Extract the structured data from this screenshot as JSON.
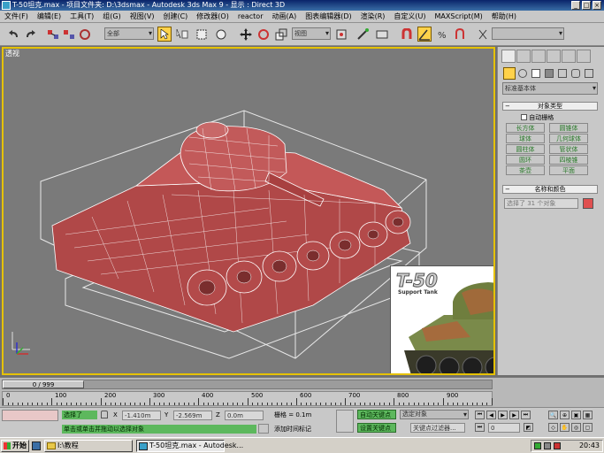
{
  "window": {
    "title": "T-50坦克.max    - 项目文件夹: D:\\3dsmax    - Autodesk 3ds Max 9    - 显示 : Direct 3D",
    "btn_min": "_",
    "btn_max": "□",
    "btn_close": "×"
  },
  "menu": [
    "文件(F)",
    "编辑(E)",
    "工具(T)",
    "组(G)",
    "视图(V)",
    "创建(C)",
    "修改器(O)",
    "reactor",
    "动画(A)",
    "图表编辑器(D)",
    "渲染(R)",
    "自定义(U)",
    "MAXScript(M)",
    "帮助(H)"
  ],
  "toolbar": {
    "selection_filter": "全部",
    "ref_coord": "视图",
    "named_sel": ""
  },
  "viewport": {
    "label": "透视",
    "ref_title": "T-50",
    "ref_subtitle": "Support Tank"
  },
  "command_panel": {
    "category": "标准基本体",
    "rollout_object_type": "对象类型",
    "autogrid": "自动栅格",
    "buttons": [
      "长方体",
      "圆锥体",
      "球体",
      "几何球体",
      "圆柱体",
      "管状体",
      "圆环",
      "四棱锥",
      "茶壶",
      "平面"
    ],
    "rollout_name_color": "名称和颜色",
    "name_field": "选择了 31 个对象",
    "color": "#e05050"
  },
  "timeline": {
    "slider": "0 / 999",
    "ticks": [
      "0",
      "100",
      "200",
      "300",
      "400",
      "500",
      "600",
      "700",
      "800",
      "900"
    ]
  },
  "status": {
    "selected": "选择了",
    "x_value": "-1.410m",
    "y_value": "-2.569m",
    "z_value": "0.0m",
    "grid": "栅格 = 0.1m",
    "auto_key": "自动关键点",
    "key_mode": "选定对象",
    "set_key": "设置关键点",
    "key_filters": "关键点过滤器...",
    "prompt": "单击或单击并拖动以选择对象",
    "add_time_tag": "添加时间标记",
    "frame": "0"
  },
  "taskbar": {
    "start": "开始",
    "folder": "I:\\教程",
    "app": "T-50坦克.max - Autodesk...",
    "clock": "20:43"
  }
}
